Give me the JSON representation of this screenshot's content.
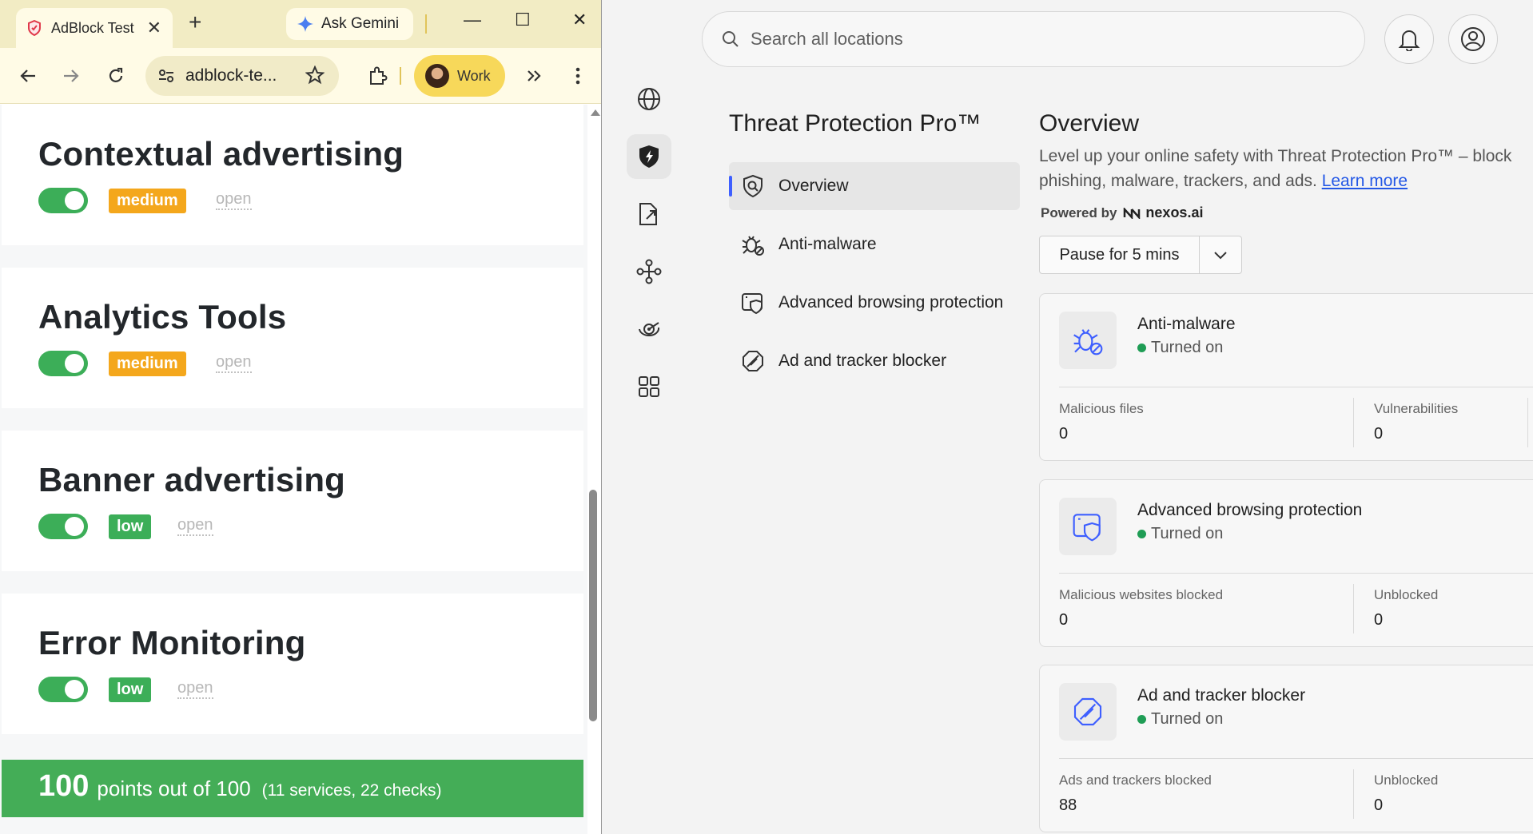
{
  "browser": {
    "tab_title": "AdBlock Test",
    "gemini_label": "Ask Gemini",
    "url": "adblock-te...",
    "profile_name": "Work",
    "cards": [
      {
        "title": "Contextual advertising",
        "level": "medium",
        "open": "open"
      },
      {
        "title": "Analytics Tools",
        "level": "medium",
        "open": "open"
      },
      {
        "title": "Banner advertising",
        "level": "low",
        "open": "open"
      },
      {
        "title": "Error Monitoring",
        "level": "low",
        "open": "open"
      }
    ],
    "score": {
      "big": "100",
      "mid": "points out of 100",
      "small": "(11 services, 22 checks)"
    }
  },
  "app": {
    "search_placeholder": "Search all locations",
    "page_title": "Threat Protection Pro™",
    "menu": [
      {
        "label": "Overview"
      },
      {
        "label": "Anti-malware"
      },
      {
        "label": "Advanced browsing protection"
      },
      {
        "label": "Ad and tracker blocker"
      }
    ],
    "overview": {
      "title": "Overview",
      "desc": "Level up your online safety with Threat Protection Pro™ – block phishing, malware, trackers, and ads.",
      "learn_more": "Learn more",
      "powered_by": "Powered by",
      "brand": "nexos.ai",
      "pause_label": "Pause for 5 mins"
    },
    "features": [
      {
        "name": "Anti-malware",
        "status": "Turned on",
        "stats": [
          {
            "label": "Malicious files",
            "value": "0"
          },
          {
            "label": "Vulnerabilities",
            "value": "0"
          }
        ]
      },
      {
        "name": "Advanced browsing protection",
        "status": "Turned on",
        "stats": [
          {
            "label": "Malicious websites blocked",
            "value": "0"
          },
          {
            "label": "Unblocked",
            "value": "0"
          }
        ]
      },
      {
        "name": "Ad and tracker blocker",
        "status": "Turned on",
        "stats": [
          {
            "label": "Ads and trackers blocked",
            "value": "88"
          },
          {
            "label": "Unblocked",
            "value": "0"
          }
        ]
      }
    ]
  },
  "colors": {
    "accent": "#3e5fff",
    "toggle_green": "#3cae58",
    "medium_badge": "#f4a71c",
    "score_green": "#44ad57",
    "status_green": "#1f9d55"
  },
  "icons": [
    "shield-icon",
    "gemini-icon",
    "back-icon",
    "forward-icon",
    "reload-icon",
    "site-settings-icon",
    "star-icon",
    "extensions-icon",
    "chevrons-icon",
    "more-icon",
    "search-icon",
    "bell-icon",
    "account-icon",
    "globe-icon",
    "threat-protection-icon",
    "file-share-icon",
    "meshnet-icon",
    "target-icon",
    "apps-icon",
    "bug-icon",
    "browser-shield-icon",
    "ad-block-icon",
    "chevron-down-icon"
  ]
}
